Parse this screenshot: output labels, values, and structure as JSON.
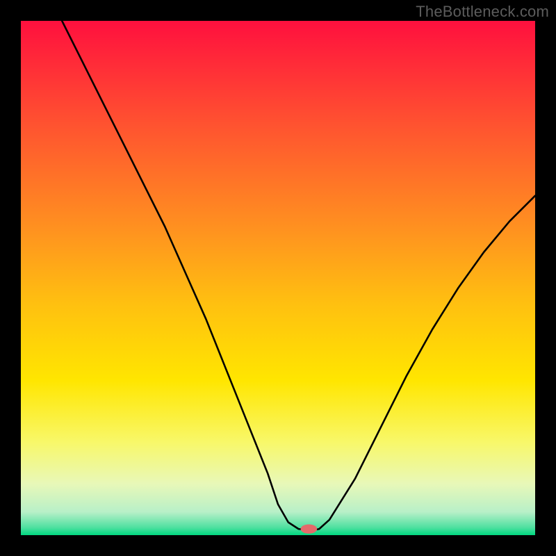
{
  "watermark": "TheBottleneck.com",
  "chart_data": {
    "type": "line",
    "title": "",
    "xlabel": "",
    "ylabel": "",
    "xlim": [
      0,
      100
    ],
    "ylim": [
      0,
      100
    ],
    "grid": false,
    "legend": false,
    "background": {
      "type": "vertical-gradient",
      "stops": [
        {
          "offset": 0.0,
          "color": "#ff103e"
        },
        {
          "offset": 0.2,
          "color": "#ff5230"
        },
        {
          "offset": 0.4,
          "color": "#ff9020"
        },
        {
          "offset": 0.55,
          "color": "#ffc010"
        },
        {
          "offset": 0.7,
          "color": "#ffe600"
        },
        {
          "offset": 0.82,
          "color": "#f8f86a"
        },
        {
          "offset": 0.9,
          "color": "#e8f8b8"
        },
        {
          "offset": 0.955,
          "color": "#b8f0c8"
        },
        {
          "offset": 0.985,
          "color": "#4fe0a0"
        },
        {
          "offset": 1.0,
          "color": "#00d880"
        }
      ]
    },
    "series": [
      {
        "name": "bottleneck-curve",
        "stroke": "#000000",
        "stroke_width": 2.6,
        "x": [
          8.0,
          12,
          16,
          20,
          24,
          28,
          32,
          36,
          40,
          44,
          48,
          50,
          52,
          54,
          56,
          57,
          58,
          60,
          65,
          70,
          75,
          80,
          85,
          90,
          95,
          100
        ],
        "y": [
          100,
          92,
          84,
          76,
          68,
          60,
          51,
          42,
          32,
          22,
          12,
          6,
          2.5,
          1.2,
          1.0,
          1.0,
          1.2,
          3,
          11,
          21,
          31,
          40,
          48,
          55,
          61,
          66
        ]
      }
    ],
    "marker": {
      "name": "optimal-point",
      "x": 56,
      "y": 1.2,
      "rx": 1.6,
      "ry": 0.9,
      "fill": "#e46a6a"
    }
  }
}
